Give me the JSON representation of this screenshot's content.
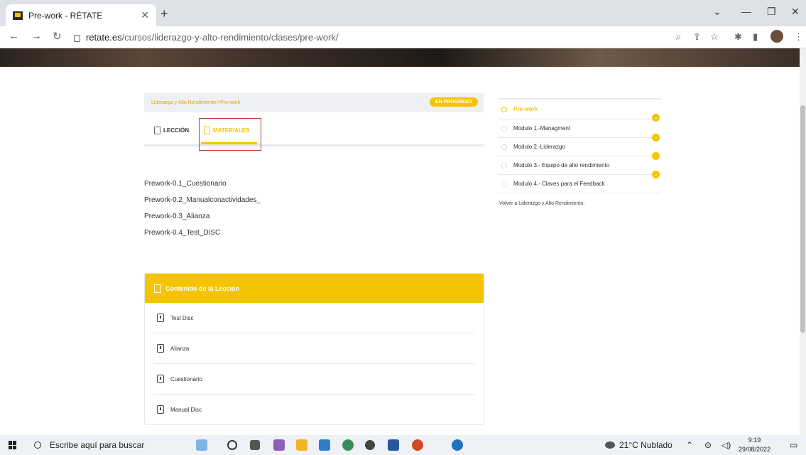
{
  "browser": {
    "tab_title": "Pre-work - RÉTATE",
    "url_host": "retate.es",
    "url_path": "/cursos/liderazgo-y-alto-rendimiento/clases/pre-work/"
  },
  "course_bar": {
    "breadcrumb_course": "Liderazgo y Alto Rendimiento.",
    "breadcrumb_sep": " > ",
    "breadcrumb_lesson": "Pre-work",
    "status": "EN PROGRESO"
  },
  "lesson_tabs": [
    {
      "label": "LECCIÓN"
    },
    {
      "label": "MATERIALES"
    }
  ],
  "materials": [
    "Prework-0.1_Cuestionario",
    "Prework-0.2_Manualconactividades_",
    "Prework-0.3_Alianza",
    "Prework-0.4_Test_DISC"
  ],
  "content": {
    "header": "Contenido de la Lección",
    "items": [
      "Test Disc",
      "Alianza",
      "Cuestionario",
      "Manual Disc"
    ]
  },
  "modules": [
    {
      "label": "Pre-work",
      "current": true
    },
    {
      "label": "Modulo 1.-Managment"
    },
    {
      "label": "Modulo 2.-Liderazgo"
    },
    {
      "label": "Modulo 3.- Equipo de alto rendimiento"
    },
    {
      "label": "Modulo 4.- Claves para el Feedback"
    }
  ],
  "back_link": "Volver a Liderazgo y Alto Rendimiento.",
  "taskbar": {
    "search_placeholder": "Escribe aquí para buscar",
    "weather": "21°C Nublado",
    "time": "9:19",
    "date": "29/08/2022"
  },
  "colors": {
    "accent": "#f5c400",
    "highlight_border": "#c0392b"
  }
}
